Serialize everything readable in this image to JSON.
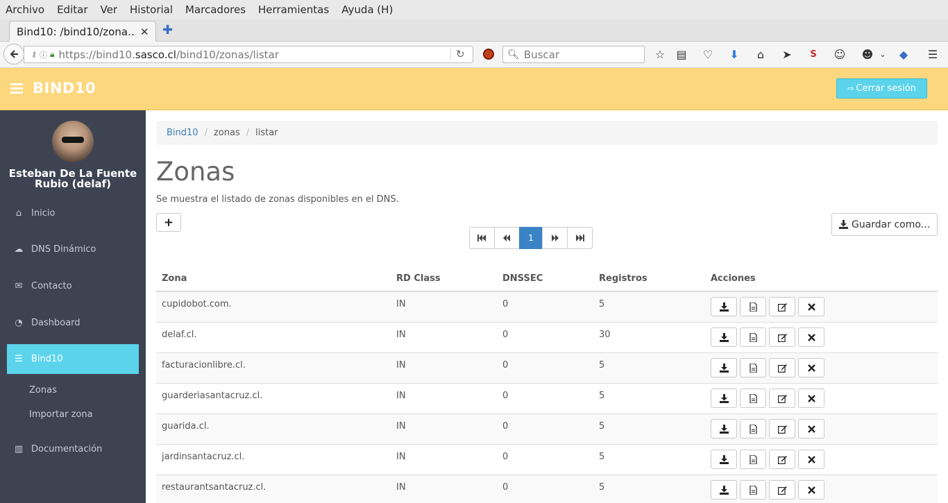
{
  "browser": {
    "menu": [
      "Archivo",
      "Editar",
      "Ver",
      "Historial",
      "Marcadores",
      "Herramientas",
      "Ayuda (H)"
    ],
    "tab_title": "Bind10: /bind10/zona…",
    "tab_close": "✕",
    "new_tab": "✚",
    "url_prefix": "https://bind10.",
    "url_domain": "sasco.cl",
    "url_path": "/bind10/zonas/listar",
    "search_placeholder": "Buscar"
  },
  "header": {
    "brand": "BIND10",
    "logout_label": "Cerrar sesión",
    "brand_color": "#fdd77e",
    "accent_color": "#5bd4eb"
  },
  "sidebar": {
    "user_line1": "Esteban De La Fuente",
    "user_line2": "Rubio (delaf)",
    "items": [
      {
        "label": "Inicio",
        "icon": "home-icon"
      },
      {
        "label": "DNS Dinámico",
        "icon": "cloud-icon"
      },
      {
        "label": "Contacto",
        "icon": "envelope-icon"
      },
      {
        "label": "Dashboard",
        "icon": "dashboard-icon"
      },
      {
        "label": "Bind10",
        "icon": "database-icon",
        "active": true
      },
      {
        "label": "Documentación",
        "icon": "book-icon"
      }
    ],
    "sub_items": [
      "Zonas",
      "Importar zona"
    ]
  },
  "main": {
    "breadcrumb": [
      "Bind10",
      "zonas",
      "listar"
    ],
    "title": "Zonas",
    "description": "Se muestra el listado de zonas disponibles en el DNS.",
    "add_label": "+",
    "save_as_label": "Guardar como...",
    "pagination": {
      "current": "1"
    },
    "table": {
      "headers": [
        "Zona",
        "RD Class",
        "DNSSEC",
        "Registros",
        "Acciones"
      ],
      "rows": [
        [
          "cupidobot.com.",
          "IN",
          "0",
          "5"
        ],
        [
          "delaf.cl.",
          "IN",
          "0",
          "30"
        ],
        [
          "facturacionlibre.cl.",
          "IN",
          "0",
          "5"
        ],
        [
          "guarderiasantacruz.cl.",
          "IN",
          "0",
          "5"
        ],
        [
          "guarida.cl.",
          "IN",
          "0",
          "5"
        ],
        [
          "jardinsantacruz.cl.",
          "IN",
          "0",
          "5"
        ],
        [
          "restaurantsantacruz.cl.",
          "IN",
          "0",
          "5"
        ]
      ]
    }
  }
}
